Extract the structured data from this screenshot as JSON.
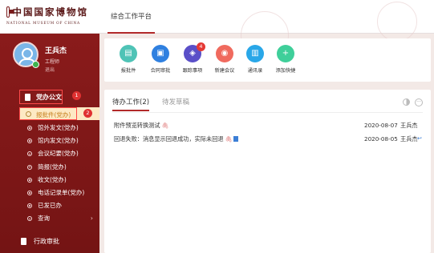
{
  "header": {
    "logo_cn": "中国国家博物馆",
    "logo_en": "NATIONAL MUSEUM OF CHINA",
    "platform_tab": "综合工作平台"
  },
  "user": {
    "name": "王兵杰",
    "role": "工程师",
    "exit": "退出"
  },
  "sidebar": {
    "section": "党办公文",
    "section_badge": "1",
    "active_item": "报批件(党办)",
    "active_badge": "2",
    "items": [
      "馆外发文(党办)",
      "馆内发文(党办)",
      "会议纪要(党办)",
      "简报(党办)",
      "收文(党办)",
      "电话记录单(党办)",
      "已发已办",
      "查询"
    ],
    "bottom": "行政审批"
  },
  "quick": [
    {
      "label": "报批件",
      "color": "#4fc3b6",
      "glyph": "▤"
    },
    {
      "label": "合同审批",
      "color": "#2f80e0",
      "glyph": "▣"
    },
    {
      "label": "跟踪事项",
      "color": "#5a4fc8",
      "glyph": "◈",
      "badge": "4"
    },
    {
      "label": "新建会议",
      "color": "#f06a5e",
      "glyph": "◉"
    },
    {
      "label": "通讯录",
      "color": "#29a7e8",
      "glyph": "▥"
    },
    {
      "label": "添加快捷",
      "color": "#3fcf9a",
      "glyph": "+"
    }
  ],
  "panel": {
    "tab_active": "待办工作(2)",
    "tab_inactive": "待发草稿",
    "more": "···",
    "rows": [
      {
        "title": "附件预览转换测试",
        "date": "2020-08-07",
        "user": "王兵杰",
        "reply": ""
      },
      {
        "title": "回退失败：消息显示回退成功，实际未回退",
        "date": "2020-08-05",
        "user": "王兵杰",
        "reply": "↩"
      }
    ]
  }
}
